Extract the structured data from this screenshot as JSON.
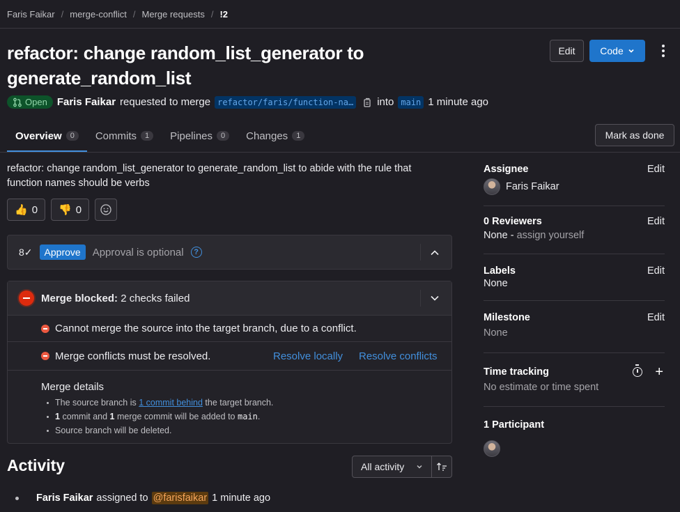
{
  "breadcrumb": [
    "Faris Faikar",
    "merge-conflict",
    "Merge requests",
    "!2"
  ],
  "title": "refactor: change random_list_generator to generate_random_list",
  "header_actions": {
    "edit": "Edit",
    "code": "Code"
  },
  "meta": {
    "status": "Open",
    "author": "Faris Faikar",
    "action": "requested to merge",
    "source_branch": "refactor/faris/function-na…",
    "into": "into",
    "target_branch": "main",
    "time": "1 minute ago"
  },
  "tabs": [
    {
      "label": "Overview",
      "count": "0"
    },
    {
      "label": "Commits",
      "count": "1"
    },
    {
      "label": "Pipelines",
      "count": "0"
    },
    {
      "label": "Changes",
      "count": "1"
    }
  ],
  "mark_done": "Mark as done",
  "description": "refactor: change random_list_generator to generate_random_list to abide with the rule that function names should be verbs",
  "reactions": {
    "thumbs_up": "0",
    "thumbs_down": "0"
  },
  "approval": {
    "icon_text": "8✓",
    "button": "Approve",
    "text": "Approval is optional",
    "help": "?"
  },
  "merge": {
    "blocked_label": "Merge blocked:",
    "blocked_detail": "2 checks failed",
    "check1": "Cannot merge the source into the target branch, due to a conflict.",
    "check2": "Merge conflicts must be resolved.",
    "resolve_locally": "Resolve locally",
    "resolve_conflicts": "Resolve conflicts",
    "details_title": "Merge details",
    "detail1_pre": "The source branch is",
    "detail1_link": "1 commit behind",
    "detail1_post": "the target branch.",
    "detail2_n1": "1",
    "detail2_mid": "commit and",
    "detail2_n2": "1",
    "detail2_post": "merge commit will be added to",
    "detail2_branch": "main",
    "detail2_end": ".",
    "detail3": "Source branch will be deleted."
  },
  "activity": {
    "title": "Activity",
    "filter": "All activity",
    "item_user": "Faris Faikar",
    "item_action": "assigned to",
    "item_mention": "@farisfaikar",
    "item_time": "1 minute ago"
  },
  "sidebar": {
    "assignee": {
      "title": "Assignee",
      "edit": "Edit",
      "name": "Faris Faikar"
    },
    "reviewers": {
      "title": "0 Reviewers",
      "edit": "Edit",
      "value": "None -",
      "assign": "assign yourself"
    },
    "labels": {
      "title": "Labels",
      "edit": "Edit",
      "value": "None"
    },
    "milestone": {
      "title": "Milestone",
      "edit": "Edit",
      "value": "None"
    },
    "time_tracking": {
      "title": "Time tracking",
      "value": "No estimate or time spent",
      "add": "+"
    },
    "participants": {
      "title": "1 Participant"
    }
  }
}
